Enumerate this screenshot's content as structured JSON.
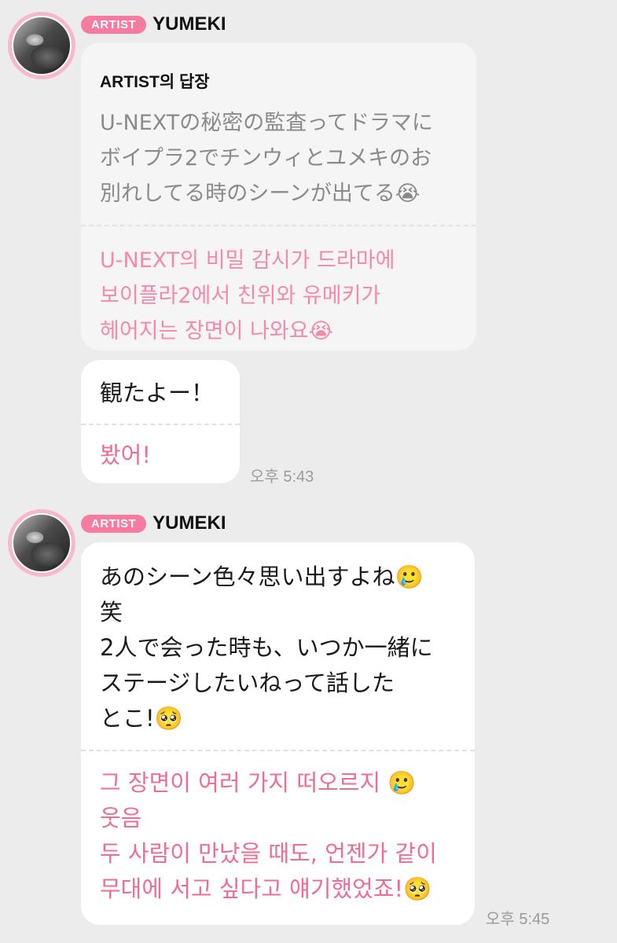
{
  "messages": [
    {
      "badge": "ARTIST",
      "sender": "YUMEKI",
      "reply_title": "ARTIST의 답장",
      "reply_original": "U-NEXTの秘密の監査ってドラマに\nボイプラ2でチンウィとユメキのお\n別れしてる時のシーンが出てる😭",
      "reply_translation": "U-NEXT의 비밀 감시가 드라마에\n보이플라2에서 친위와 유메키가\n헤어지는 장면이 나와요😭",
      "message_original": "観たよー！",
      "message_translation": "봤어!",
      "time": "오후 5:43"
    },
    {
      "badge": "ARTIST",
      "sender": "YUMEKI",
      "message_original": "あのシーン色々思い出すよね🥲\n笑\n2人で会った時も、いつか一緒に\nステージしたいねって話した\nとこ!🥺",
      "message_translation": "그 장면이 여러 가지 떠오르지 🥲\n웃음\n두 사람이 만났을 때도, 언젠가 같이\n무대에 서고 싶다고 얘기했었죠!🥺",
      "time": "오후 5:45"
    }
  ]
}
